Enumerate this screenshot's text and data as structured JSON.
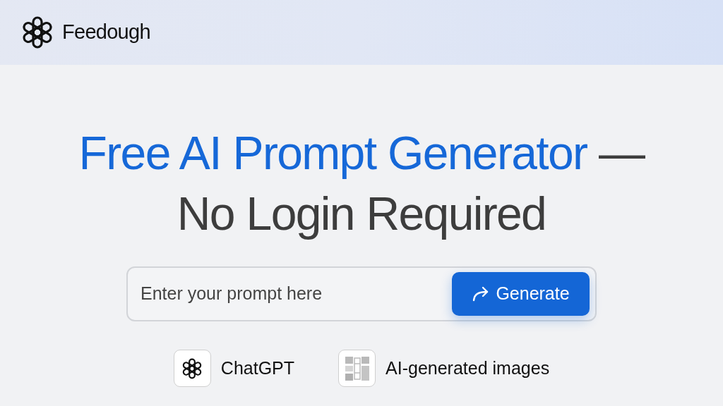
{
  "brand": {
    "name": "Feedough"
  },
  "heading": [
    {
      "text": "Free AI Prompt Generator",
      "accent": true,
      "new_line": false
    },
    {
      "text": "—",
      "accent": false,
      "new_line": false
    },
    {
      "text": "No Login Required",
      "accent": false,
      "new_line": true
    }
  ],
  "prompt": {
    "placeholder": "Enter your prompt here",
    "button": "Generate"
  },
  "features": [
    {
      "kind": "chatbot",
      "label": "ChatGPT"
    },
    {
      "kind": "images",
      "label": "AI-generated images"
    }
  ]
}
